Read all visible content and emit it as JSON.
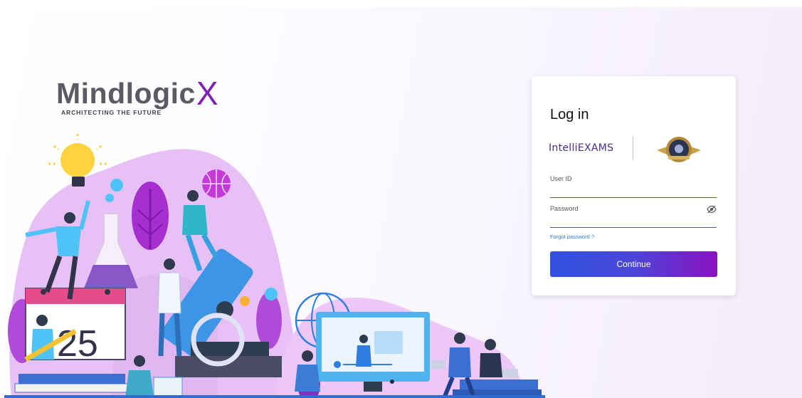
{
  "brand": {
    "name": "Mindlogic",
    "name_accent": "X",
    "tagline": "ARCHITECTING THE FUTURE"
  },
  "illustration": {
    "calendar_number": "25"
  },
  "login": {
    "title": "Log in",
    "partner_logo_text": "IntelliEXAMS",
    "user_id_label": "User ID",
    "user_id_value": "",
    "password_label": "Password",
    "password_value": "",
    "forgot_password": "Forgot password ?",
    "continue_label": "Continue"
  },
  "icons": {
    "password_toggle": "eye-off-icon",
    "institution_logo": "seal-icon"
  },
  "colors": {
    "brand_text": "#5b5b66",
    "brand_accent": "#7d22b5",
    "input_underline": "#3f51d9",
    "link": "#2a7de1",
    "button_gradient_start": "#2f52de",
    "button_gradient_end": "#8a12c2"
  }
}
